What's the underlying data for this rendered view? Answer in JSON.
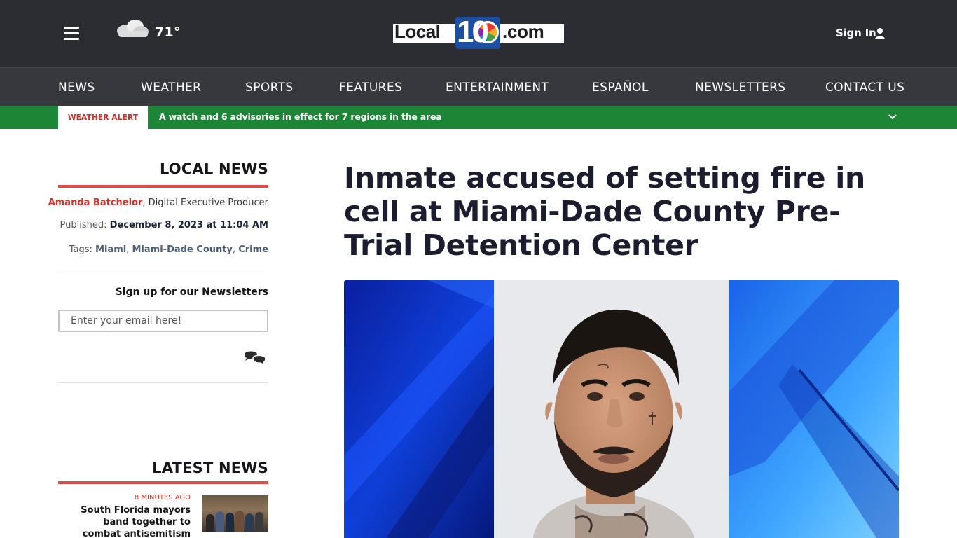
{
  "header": {
    "weather_temp": "71°",
    "logo_left": "Local",
    "logo_ten": "10",
    "logo_right": ".com",
    "signin_label": "Sign In"
  },
  "nav": {
    "items": [
      "NEWS",
      "WEATHER",
      "SPORTS",
      "FEATURES",
      "ENTERTAINMENT",
      "ESPAÑOL",
      "NEWSLETTERS",
      "CONTACT US"
    ]
  },
  "alert": {
    "label": "WEATHER ALERT",
    "text": "A watch and 6 advisories in effect for 7 regions in the area"
  },
  "sidebar": {
    "section_heading": "LOCAL NEWS",
    "author_name": "Amanda Batchelor",
    "author_role": ", Digital Executive Producer",
    "published_label": "Published: ",
    "published_date": "December 8, 2023 at 11:04 AM",
    "tags_label": "Tags: ",
    "tags": [
      "Miami",
      "Miami-Dade County",
      "Crime"
    ],
    "newsletter_heading": "Sign up for our Newsletters",
    "email_placeholder": "Enter your email here!",
    "latest_heading": "LATEST NEWS",
    "latest": [
      {
        "time": "8 MINUTES AGO",
        "title": "South Florida mayors band together to combat antisemitism"
      }
    ]
  },
  "article": {
    "headline": "Inmate accused of setting fire in cell at Miami-Dade County Pre-Trial Detention Center"
  },
  "colors": {
    "header_bg": "#2c2d33",
    "nav_bg": "#37383e",
    "alert_green": "#1c8636",
    "accent_red": "#e04c43"
  }
}
